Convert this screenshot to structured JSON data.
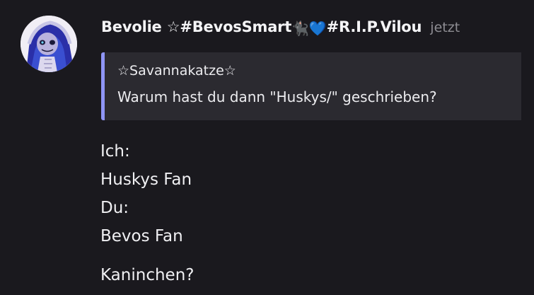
{
  "message": {
    "author": {
      "name_prefix": "Bevolie ☆#BevosSmart",
      "cat_emoji": "🐈‍⬛",
      "heart_emoji": "💙",
      "name_suffix": "#R.I.P.Vilou"
    },
    "timestamp": "jetzt",
    "quote": {
      "author": "☆Savannakatze☆",
      "text": "Warum hast du dann \"Huskys/\" geschrieben?"
    },
    "lines": [
      "Ich:",
      "Huskys Fan",
      "Du:",
      "Bevos Fan"
    ],
    "last_line": "Kaninchen?"
  },
  "colors": {
    "background": "#1a191e",
    "quote_background": "#2b2a30",
    "quote_accent": "#8f95f5",
    "text": "#ececef",
    "muted": "#8e8d93",
    "heart": "#2f8df5"
  },
  "icons": {
    "avatar": "avatar-image",
    "cat": "black-cat-emoji",
    "heart": "blue-heart-emoji"
  }
}
